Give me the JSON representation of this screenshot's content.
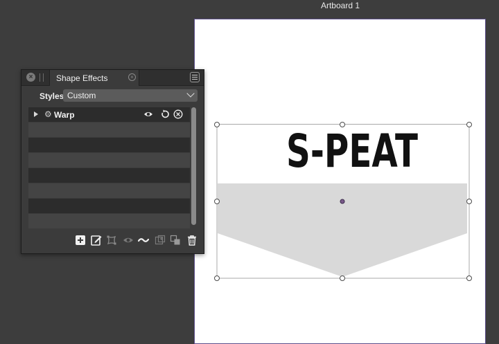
{
  "canvas": {
    "artboard_title": "Artboard 1",
    "artwork_text": "S-PEAT"
  },
  "panel": {
    "tab_label": "Shape Effects",
    "styles_label": "Styles",
    "styles_value": "Custom",
    "effects": [
      {
        "label": "Warp"
      }
    ]
  },
  "icons": {
    "panel_close": "close-icon",
    "tab_close": "close-icon",
    "panel_menu": "hamburger-menu-icon",
    "expand": "triangle-right-icon",
    "effect_type": "gear-icon",
    "visibility": "eye-icon",
    "reset": "reset-icon",
    "remove": "circle-x-icon",
    "footer": [
      "add-icon",
      "edit-icon",
      "warp-shape-icon",
      "eye-icon",
      "wave-icon",
      "add-frame-icon",
      "duplicate-icon",
      "trash-icon"
    ]
  },
  "colors": {
    "app_background": "#3d3d3d",
    "panel_background": "#3b3b3b",
    "artboard": "#ffffff",
    "shape_fill": "#d9d9d9",
    "text": "#111111",
    "selection": "#9a9a9a"
  }
}
